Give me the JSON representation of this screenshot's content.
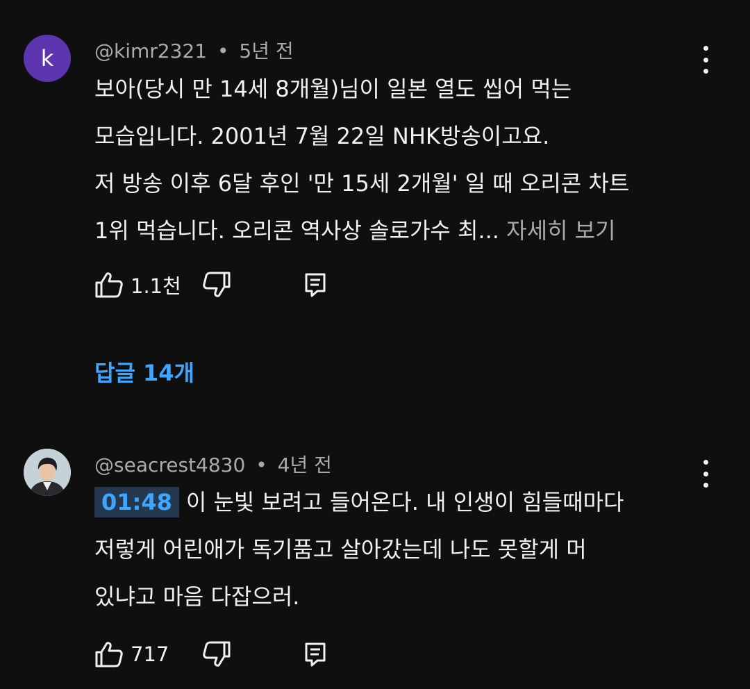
{
  "comments": [
    {
      "avatar_letter": "k",
      "author": "@kimr2321",
      "separator": "•",
      "time": "5년 전",
      "lines": [
        "보아(당시 만 14세 8개월)님이 일본 열도 씹어 먹는",
        "모습입니다. 2001년 7월 22일 NHK방송이고요.",
        "저 방송 이후 6달 후인 '만 15세 2개월' 일 때 오리콘 차트"
      ],
      "last_line": "1위 먹습니다. 오리콘 역사상 솔로가수 최...",
      "more_label": "자세히 보기",
      "likes": "1.1천",
      "replies_label": "답글 14개"
    },
    {
      "author": "@seacrest4830",
      "separator": "•",
      "time": "4년 전",
      "timestamp": "01:48",
      "first_line_rest": "이 눈빛 보려고 들어온다. 내 인생이 힘들때마다",
      "lines": [
        "저렇게 어린애가 독기품고 살아갔는데 나도 못할게 머",
        "있냐고 마음 다잡으러."
      ],
      "likes": "717"
    }
  ],
  "colors": {
    "background": "#0f0f0f",
    "text": "#f1f1f1",
    "secondary": "#aaaaaa",
    "link": "#3ea6ff",
    "avatar_k": "#5e35b1"
  },
  "icons": [
    "thumbs-up-icon",
    "thumbs-down-icon",
    "reply-icon",
    "more-vert-icon"
  ]
}
